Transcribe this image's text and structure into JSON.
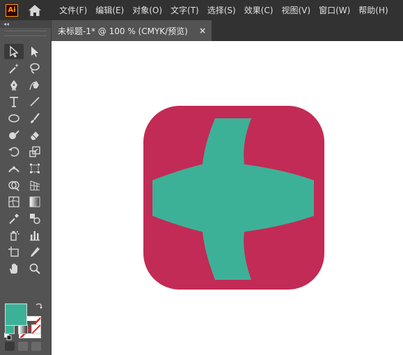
{
  "app": {
    "logo_text": "Ai"
  },
  "menu": {
    "items": [
      "文件(F)",
      "编辑(E)",
      "对象(O)",
      "文字(T)",
      "选择(S)",
      "效果(C)",
      "视图(V)",
      "窗口(W)",
      "帮助(H)"
    ]
  },
  "toolbar": {
    "collapse_glyph": "◂◂",
    "tools": [
      {
        "name": "selection-tool",
        "icon": "selection-arrow-icon"
      },
      {
        "name": "direct-selection-tool",
        "icon": "direct-selection-arrow-icon"
      },
      {
        "name": "magic-wand-tool",
        "icon": "magic-wand-icon"
      },
      {
        "name": "lasso-tool",
        "icon": "lasso-icon"
      },
      {
        "name": "pen-tool",
        "icon": "pen-icon"
      },
      {
        "name": "curvature-tool",
        "icon": "curvature-pen-icon"
      },
      {
        "name": "type-tool",
        "icon": "type-icon"
      },
      {
        "name": "line-tool",
        "icon": "line-icon"
      },
      {
        "name": "ellipse-tool",
        "icon": "ellipse-icon"
      },
      {
        "name": "paintbrush-tool",
        "icon": "paintbrush-icon"
      },
      {
        "name": "shaper-tool",
        "icon": "shaper-icon"
      },
      {
        "name": "eraser-tool",
        "icon": "eraser-icon"
      },
      {
        "name": "rotate-tool",
        "icon": "rotate-icon"
      },
      {
        "name": "scale-tool",
        "icon": "scale-icon"
      },
      {
        "name": "width-tool",
        "icon": "width-icon"
      },
      {
        "name": "free-transform-tool",
        "icon": "free-transform-icon"
      },
      {
        "name": "shape-builder-tool",
        "icon": "shape-builder-icon"
      },
      {
        "name": "perspective-grid-tool",
        "icon": "perspective-grid-icon"
      },
      {
        "name": "mesh-tool",
        "icon": "mesh-icon"
      },
      {
        "name": "gradient-tool",
        "icon": "gradient-icon"
      },
      {
        "name": "eyedropper-tool",
        "icon": "eyedropper-icon"
      },
      {
        "name": "blend-tool",
        "icon": "blend-icon"
      },
      {
        "name": "symbol-sprayer-tool",
        "icon": "symbol-sprayer-icon"
      },
      {
        "name": "column-graph-tool",
        "icon": "column-graph-icon"
      },
      {
        "name": "artboard-tool",
        "icon": "artboard-icon"
      },
      {
        "name": "slice-tool",
        "icon": "slice-icon"
      },
      {
        "name": "hand-tool",
        "icon": "hand-icon"
      },
      {
        "name": "zoom-tool",
        "icon": "zoom-icon"
      }
    ],
    "fill_color": "#3db198",
    "stroke_color": "none"
  },
  "tab": {
    "title": "未标题-1* @ 100 % (CMYK/预览)",
    "close_glyph": "×"
  },
  "artwork": {
    "background_color": "#c22b55",
    "cross_color": "#3db198"
  }
}
